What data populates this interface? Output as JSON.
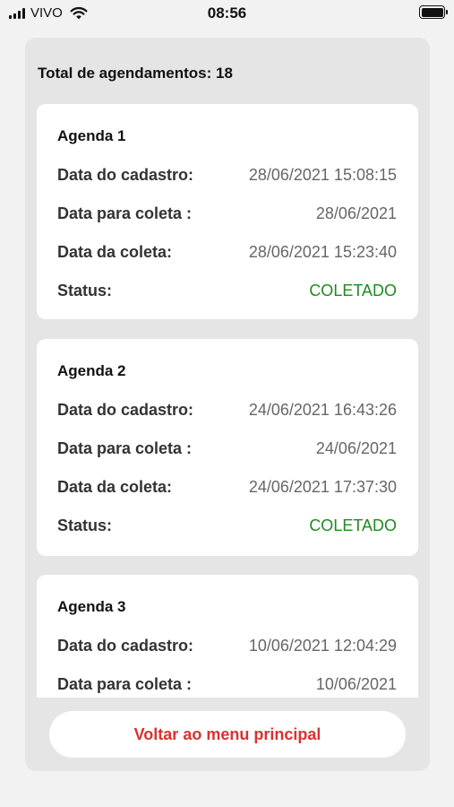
{
  "status_bar": {
    "carrier": "VIVO",
    "time": "08:56"
  },
  "summary": {
    "total_label": "Total de agendamentos: 18"
  },
  "labels": {
    "data_cadastro": "Data do cadastro:",
    "data_para_coleta": "Data para coleta :",
    "data_da_coleta": "Data da coleta:",
    "status": "Status:"
  },
  "agendas": [
    {
      "title": "Agenda 1",
      "data_cadastro": "28/06/2021 15:08:15",
      "data_para_coleta": "28/06/2021",
      "data_da_coleta": "28/06/2021 15:23:40",
      "status": "COLETADO"
    },
    {
      "title": "Agenda 2",
      "data_cadastro": "24/06/2021 16:43:26",
      "data_para_coleta": "24/06/2021",
      "data_da_coleta": "24/06/2021 17:37:30",
      "status": "COLETADO"
    },
    {
      "title": "Agenda 3",
      "data_cadastro": "10/06/2021 12:04:29",
      "data_para_coleta": "10/06/2021"
    }
  ],
  "actions": {
    "back_label": "Voltar ao menu principal"
  },
  "colors": {
    "status_ok": "#1e8a1e",
    "action_text": "#d9322e",
    "panel_bg": "#e5e5e5",
    "card_bg": "#ffffff"
  }
}
